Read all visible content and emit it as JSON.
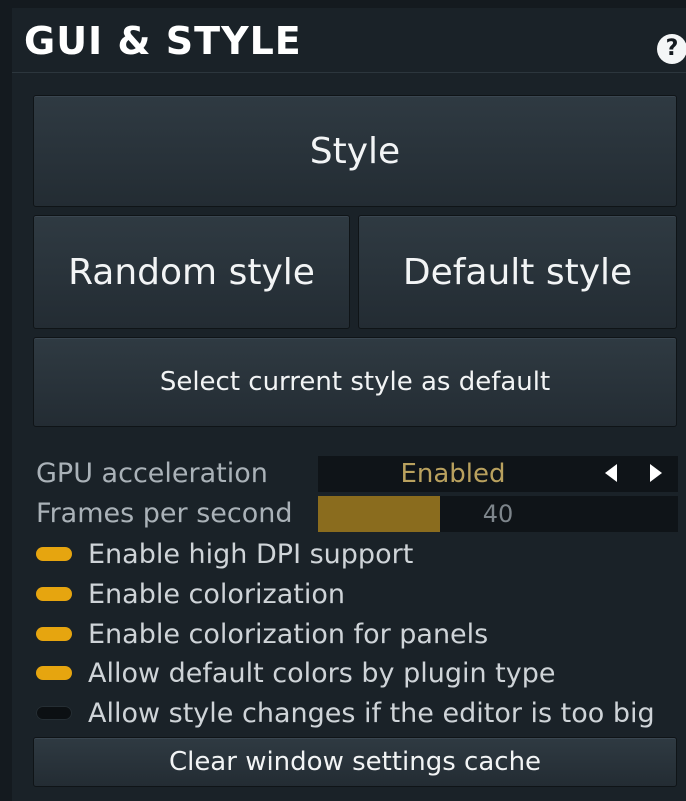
{
  "header": {
    "title": "GUI & STYLE",
    "help_label": "?"
  },
  "buttons": {
    "style": "Style",
    "random_style": "Random style",
    "default_style": "Default style",
    "select_default": "Select current style as default",
    "clear_cache": "Clear window settings cache"
  },
  "gpu": {
    "label": "GPU acceleration",
    "value": "Enabled"
  },
  "fps": {
    "label": "Frames per second",
    "value": "40",
    "fill_fraction": 0.34
  },
  "checkboxes": [
    {
      "label": "Enable high DPI support",
      "checked": true
    },
    {
      "label": "Enable colorization",
      "checked": true
    },
    {
      "label": "Enable colorization for panels",
      "checked": true
    },
    {
      "label": "Allow default colors by plugin type",
      "checked": true
    },
    {
      "label": "Allow style changes if the editor is too big",
      "checked": false
    }
  ],
  "colors": {
    "accent": "#e6a50f",
    "slider_fill": "#8a6c1e",
    "value_text": "#b9a15e"
  }
}
